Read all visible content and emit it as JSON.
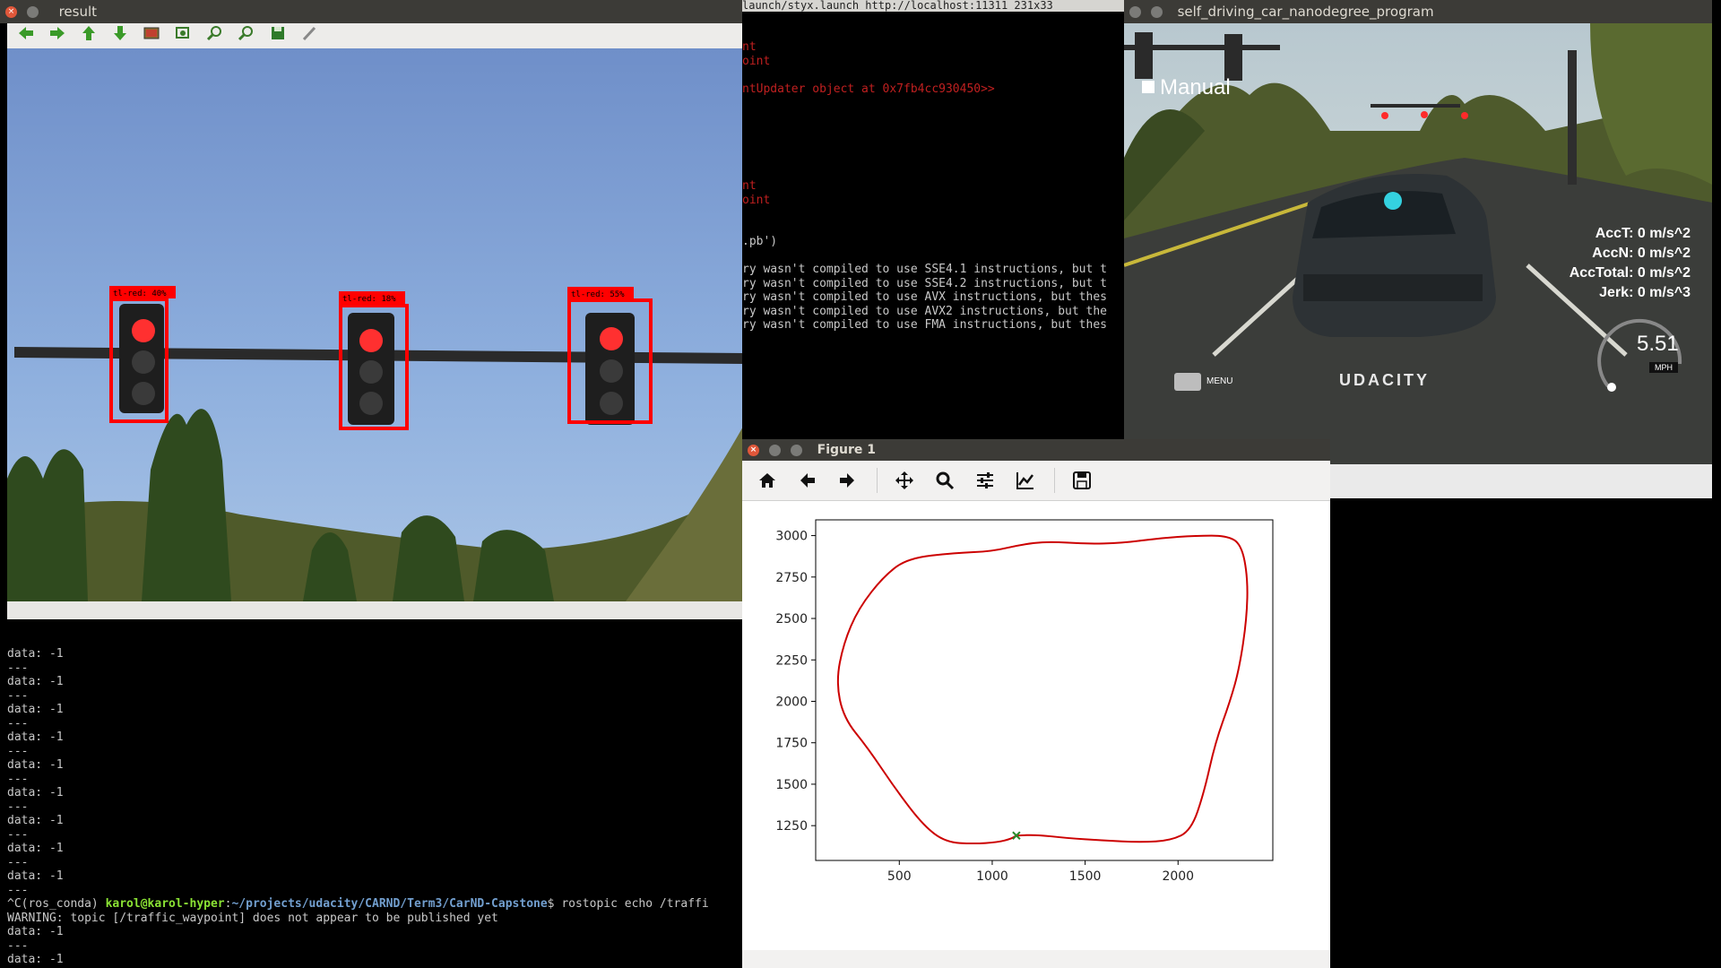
{
  "result_window": {
    "title": "result",
    "toolbar_icons": [
      "left-arrow-icon",
      "right-arrow-icon",
      "up-arrow-icon",
      "down-arrow-icon",
      "image-icon",
      "zoom-fit-icon",
      "zoom-in-icon",
      "zoom-out-icon",
      "save-icon",
      "brush-icon"
    ],
    "detections": [
      {
        "label": "tl-red: 40%"
      },
      {
        "label": "tl-red: 18%"
      },
      {
        "label": "tl-red: 55%"
      }
    ]
  },
  "launch_terminal": {
    "title": "launch/styx.launch http://localhost:11311 231x33",
    "lines": [
      {
        "text": "nt",
        "color": "red"
      },
      {
        "text": "oint",
        "color": "red"
      },
      {
        "text": "",
        "color": "red"
      },
      {
        "text": "ntUpdater object at 0x7fb4cc930450>>",
        "color": "red"
      },
      {
        "text": "",
        "color": "red"
      },
      {
        "text": "nt",
        "color": "red"
      },
      {
        "text": "oint",
        "color": "red"
      },
      {
        "text": "",
        "color": "red"
      },
      {
        "text": ".pb')",
        "color": "white"
      },
      {
        "text": "ry wasn't compiled to use SSE4.1 instructions, but t",
        "color": "white"
      },
      {
        "text": "ry wasn't compiled to use SSE4.2 instructions, but t",
        "color": "white"
      },
      {
        "text": "ry wasn't compiled to use AVX instructions, but thes",
        "color": "white"
      },
      {
        "text": "ry wasn't compiled to use AVX2 instructions, but the",
        "color": "white"
      },
      {
        "text": "ry wasn't compiled to use FMA instructions, but thes",
        "color": "white"
      }
    ]
  },
  "simulator": {
    "title": "self_driving_car_nanodegree_program",
    "manual_label": "Manual",
    "menu_label": "MENU",
    "acc_t": "AccT: 0 m/s^2",
    "acc_n": "AccN: 0 m/s^2",
    "acc_total": "AccTotal: 0 m/s^2",
    "jerk": "Jerk: 0 m/s^3",
    "speed": "5.51",
    "speed_unit": "MPH",
    "car_logo": "UDACITY"
  },
  "echo_terminal": {
    "lines_top": [
      "data: -1",
      "---",
      "data: -1",
      "---",
      "data: -1",
      "---",
      "data: -1",
      "---",
      "data: -1",
      "---",
      "data: -1",
      "---",
      "data: -1",
      "---",
      "data: -1",
      "---",
      "data: -1",
      "---"
    ],
    "prompt_env": "^C(ros_conda) ",
    "prompt_user": "karol@karol-hyper",
    "prompt_sep": ":",
    "prompt_path": "~/projects/udacity/CARND/Term3/CarND-Capstone",
    "prompt_cmd": "$ rostopic echo /traffi",
    "warning": "WARNING: topic [/traffic_waypoint] does not appear to be published yet",
    "lines_bottom": [
      "data: -1",
      "---",
      "data: -1",
      "---"
    ],
    "cursor": "▌"
  },
  "figure": {
    "title": "Figure 1",
    "toolbar_icons": [
      "home-icon",
      "back-arrow-icon",
      "forward-arrow-icon",
      "pan-icon",
      "zoom-icon",
      "subplots-icon",
      "axes-edit-icon",
      "save-icon"
    ]
  },
  "chart_data": {
    "type": "line",
    "xlabel": "",
    "ylabel": "",
    "xlim": [
      50,
      2510
    ],
    "ylim": [
      1040,
      3095
    ],
    "x_ticks": [
      500,
      1000,
      1500,
      2000
    ],
    "y_ticks": [
      1250,
      1500,
      1750,
      2000,
      2250,
      2500,
      2750,
      3000
    ],
    "series": [
      {
        "color": "#cc0000",
        "points": [
          [
            1130,
            1190
          ],
          [
            1240,
            1195
          ],
          [
            1400,
            1175
          ],
          [
            1600,
            1160
          ],
          [
            1800,
            1150
          ],
          [
            1960,
            1160
          ],
          [
            2070,
            1220
          ],
          [
            2140,
            1450
          ],
          [
            2200,
            1750
          ],
          [
            2280,
            2000
          ],
          [
            2330,
            2200
          ],
          [
            2370,
            2500
          ],
          [
            2375,
            2750
          ],
          [
            2340,
            2950
          ],
          [
            2260,
            3000
          ],
          [
            2100,
            3000
          ],
          [
            1900,
            2985
          ],
          [
            1700,
            2955
          ],
          [
            1500,
            2950
          ],
          [
            1300,
            2965
          ],
          [
            1150,
            2945
          ],
          [
            1000,
            2905
          ],
          [
            800,
            2895
          ],
          [
            550,
            2865
          ],
          [
            420,
            2760
          ],
          [
            280,
            2560
          ],
          [
            200,
            2350
          ],
          [
            160,
            2120
          ],
          [
            200,
            1900
          ],
          [
            330,
            1720
          ],
          [
            480,
            1470
          ],
          [
            630,
            1250
          ],
          [
            750,
            1150
          ],
          [
            900,
            1140
          ],
          [
            1030,
            1150
          ],
          [
            1100,
            1170
          ],
          [
            1130,
            1190
          ]
        ]
      }
    ],
    "markers": [
      {
        "x": 1130,
        "y": 1190,
        "symbol": "x",
        "color": "#2a8a2a"
      }
    ]
  },
  "colors": {
    "window_title_bg": "#3c3b37",
    "detection_box": "#ff0000",
    "prompt_user": "#8ae234",
    "prompt_path": "#729fcf",
    "trajectory": "#cc0000"
  }
}
